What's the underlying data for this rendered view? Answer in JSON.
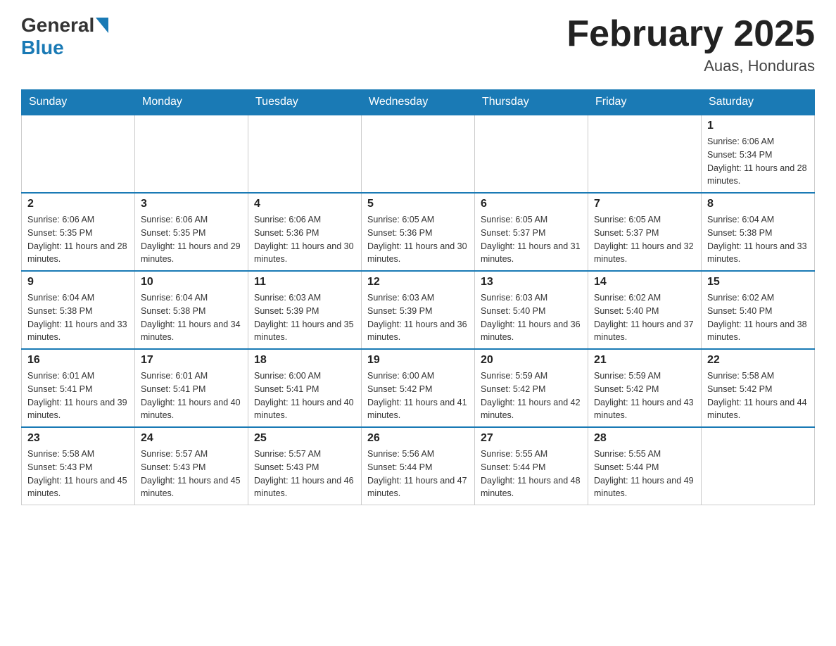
{
  "header": {
    "logo": {
      "general": "General",
      "blue": "Blue"
    },
    "title": "February 2025",
    "location": "Auas, Honduras"
  },
  "days_of_week": [
    "Sunday",
    "Monday",
    "Tuesday",
    "Wednesday",
    "Thursday",
    "Friday",
    "Saturday"
  ],
  "weeks": [
    [
      {
        "day": "",
        "sunrise": "",
        "sunset": "",
        "daylight": "",
        "empty": true
      },
      {
        "day": "",
        "sunrise": "",
        "sunset": "",
        "daylight": "",
        "empty": true
      },
      {
        "day": "",
        "sunrise": "",
        "sunset": "",
        "daylight": "",
        "empty": true
      },
      {
        "day": "",
        "sunrise": "",
        "sunset": "",
        "daylight": "",
        "empty": true
      },
      {
        "day": "",
        "sunrise": "",
        "sunset": "",
        "daylight": "",
        "empty": true
      },
      {
        "day": "",
        "sunrise": "",
        "sunset": "",
        "daylight": "",
        "empty": true
      },
      {
        "day": "1",
        "sunrise": "Sunrise: 6:06 AM",
        "sunset": "Sunset: 5:34 PM",
        "daylight": "Daylight: 11 hours and 28 minutes.",
        "empty": false
      }
    ],
    [
      {
        "day": "2",
        "sunrise": "Sunrise: 6:06 AM",
        "sunset": "Sunset: 5:35 PM",
        "daylight": "Daylight: 11 hours and 28 minutes.",
        "empty": false
      },
      {
        "day": "3",
        "sunrise": "Sunrise: 6:06 AM",
        "sunset": "Sunset: 5:35 PM",
        "daylight": "Daylight: 11 hours and 29 minutes.",
        "empty": false
      },
      {
        "day": "4",
        "sunrise": "Sunrise: 6:06 AM",
        "sunset": "Sunset: 5:36 PM",
        "daylight": "Daylight: 11 hours and 30 minutes.",
        "empty": false
      },
      {
        "day": "5",
        "sunrise": "Sunrise: 6:05 AM",
        "sunset": "Sunset: 5:36 PM",
        "daylight": "Daylight: 11 hours and 30 minutes.",
        "empty": false
      },
      {
        "day": "6",
        "sunrise": "Sunrise: 6:05 AM",
        "sunset": "Sunset: 5:37 PM",
        "daylight": "Daylight: 11 hours and 31 minutes.",
        "empty": false
      },
      {
        "day": "7",
        "sunrise": "Sunrise: 6:05 AM",
        "sunset": "Sunset: 5:37 PM",
        "daylight": "Daylight: 11 hours and 32 minutes.",
        "empty": false
      },
      {
        "day": "8",
        "sunrise": "Sunrise: 6:04 AM",
        "sunset": "Sunset: 5:38 PM",
        "daylight": "Daylight: 11 hours and 33 minutes.",
        "empty": false
      }
    ],
    [
      {
        "day": "9",
        "sunrise": "Sunrise: 6:04 AM",
        "sunset": "Sunset: 5:38 PM",
        "daylight": "Daylight: 11 hours and 33 minutes.",
        "empty": false
      },
      {
        "day": "10",
        "sunrise": "Sunrise: 6:04 AM",
        "sunset": "Sunset: 5:38 PM",
        "daylight": "Daylight: 11 hours and 34 minutes.",
        "empty": false
      },
      {
        "day": "11",
        "sunrise": "Sunrise: 6:03 AM",
        "sunset": "Sunset: 5:39 PM",
        "daylight": "Daylight: 11 hours and 35 minutes.",
        "empty": false
      },
      {
        "day": "12",
        "sunrise": "Sunrise: 6:03 AM",
        "sunset": "Sunset: 5:39 PM",
        "daylight": "Daylight: 11 hours and 36 minutes.",
        "empty": false
      },
      {
        "day": "13",
        "sunrise": "Sunrise: 6:03 AM",
        "sunset": "Sunset: 5:40 PM",
        "daylight": "Daylight: 11 hours and 36 minutes.",
        "empty": false
      },
      {
        "day": "14",
        "sunrise": "Sunrise: 6:02 AM",
        "sunset": "Sunset: 5:40 PM",
        "daylight": "Daylight: 11 hours and 37 minutes.",
        "empty": false
      },
      {
        "day": "15",
        "sunrise": "Sunrise: 6:02 AM",
        "sunset": "Sunset: 5:40 PM",
        "daylight": "Daylight: 11 hours and 38 minutes.",
        "empty": false
      }
    ],
    [
      {
        "day": "16",
        "sunrise": "Sunrise: 6:01 AM",
        "sunset": "Sunset: 5:41 PM",
        "daylight": "Daylight: 11 hours and 39 minutes.",
        "empty": false
      },
      {
        "day": "17",
        "sunrise": "Sunrise: 6:01 AM",
        "sunset": "Sunset: 5:41 PM",
        "daylight": "Daylight: 11 hours and 40 minutes.",
        "empty": false
      },
      {
        "day": "18",
        "sunrise": "Sunrise: 6:00 AM",
        "sunset": "Sunset: 5:41 PM",
        "daylight": "Daylight: 11 hours and 40 minutes.",
        "empty": false
      },
      {
        "day": "19",
        "sunrise": "Sunrise: 6:00 AM",
        "sunset": "Sunset: 5:42 PM",
        "daylight": "Daylight: 11 hours and 41 minutes.",
        "empty": false
      },
      {
        "day": "20",
        "sunrise": "Sunrise: 5:59 AM",
        "sunset": "Sunset: 5:42 PM",
        "daylight": "Daylight: 11 hours and 42 minutes.",
        "empty": false
      },
      {
        "day": "21",
        "sunrise": "Sunrise: 5:59 AM",
        "sunset": "Sunset: 5:42 PM",
        "daylight": "Daylight: 11 hours and 43 minutes.",
        "empty": false
      },
      {
        "day": "22",
        "sunrise": "Sunrise: 5:58 AM",
        "sunset": "Sunset: 5:42 PM",
        "daylight": "Daylight: 11 hours and 44 minutes.",
        "empty": false
      }
    ],
    [
      {
        "day": "23",
        "sunrise": "Sunrise: 5:58 AM",
        "sunset": "Sunset: 5:43 PM",
        "daylight": "Daylight: 11 hours and 45 minutes.",
        "empty": false
      },
      {
        "day": "24",
        "sunrise": "Sunrise: 5:57 AM",
        "sunset": "Sunset: 5:43 PM",
        "daylight": "Daylight: 11 hours and 45 minutes.",
        "empty": false
      },
      {
        "day": "25",
        "sunrise": "Sunrise: 5:57 AM",
        "sunset": "Sunset: 5:43 PM",
        "daylight": "Daylight: 11 hours and 46 minutes.",
        "empty": false
      },
      {
        "day": "26",
        "sunrise": "Sunrise: 5:56 AM",
        "sunset": "Sunset: 5:44 PM",
        "daylight": "Daylight: 11 hours and 47 minutes.",
        "empty": false
      },
      {
        "day": "27",
        "sunrise": "Sunrise: 5:55 AM",
        "sunset": "Sunset: 5:44 PM",
        "daylight": "Daylight: 11 hours and 48 minutes.",
        "empty": false
      },
      {
        "day": "28",
        "sunrise": "Sunrise: 5:55 AM",
        "sunset": "Sunset: 5:44 PM",
        "daylight": "Daylight: 11 hours and 49 minutes.",
        "empty": false
      },
      {
        "day": "",
        "sunrise": "",
        "sunset": "",
        "daylight": "",
        "empty": true
      }
    ]
  ]
}
